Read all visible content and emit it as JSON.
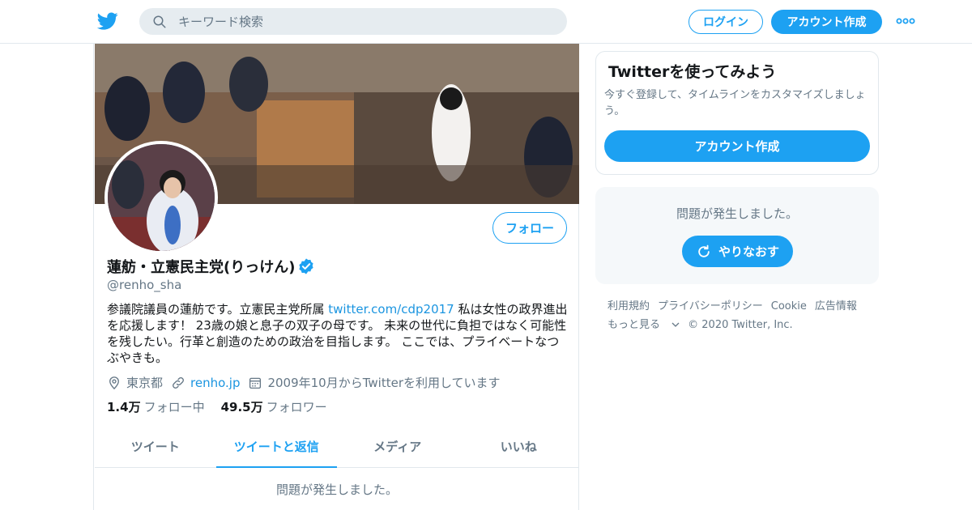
{
  "header": {
    "search_placeholder": "キーワード検索",
    "login_label": "ログイン",
    "signup_label": "アカウント作成",
    "logo_icon": "twitter-bird-icon",
    "brand_color": "#1da1f2"
  },
  "profile": {
    "display_name": "蓮舫・立憲民主党(りっけん)",
    "handle": "@renho_sha",
    "verified": true,
    "follow_label": "フォロー",
    "bio_before_link": "参議院議員の蓮舫です。立憲民主党所属 ",
    "bio_link": "twitter.com/cdp2017",
    "bio_after_link": " 私は女性の政界進出を応援します！ 23歳の娘と息子の双子の母です。 未来の世代に負担ではなく可能性を残したい。行革と創造のための政治を目指します。 ここでは、プライベートなつぶやきも。",
    "location": "東京都",
    "website": "renho.jp",
    "joined": "2009年10月からTwitterを利用しています",
    "following_count": "1.4万",
    "following_label": "フォロー中",
    "followers_count": "49.5万",
    "followers_label": "フォロワー"
  },
  "tabs": [
    {
      "label": "ツイート",
      "active": false
    },
    {
      "label": "ツイートと返信",
      "active": true
    },
    {
      "label": "メディア",
      "active": false
    },
    {
      "label": "いいね",
      "active": false
    }
  ],
  "timeline": {
    "error_message": "問題が発生しました。"
  },
  "sidebar": {
    "signup_card": {
      "title": "Twitterを使ってみよう",
      "description": "今すぐ登録して、タイムラインをカスタマイズしましょう。",
      "button_label": "アカウント作成"
    },
    "error_card": {
      "message": "問題が発生しました。",
      "retry_label": "やりなおす"
    },
    "footer_links": [
      "利用規約",
      "プライバシーポリシー",
      "Cookie",
      "広告情報",
      "もっと見る",
      "© 2020 Twitter, Inc."
    ]
  }
}
